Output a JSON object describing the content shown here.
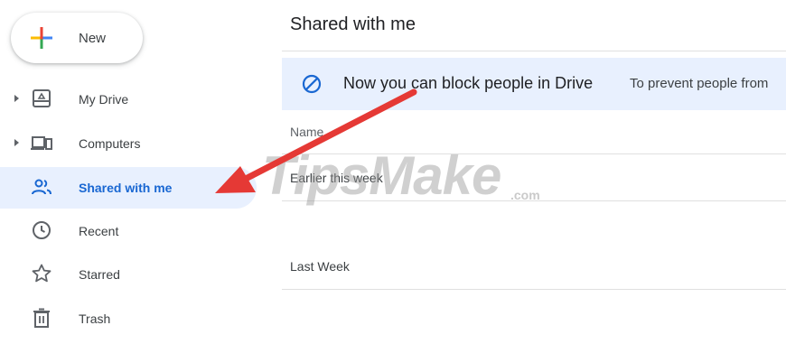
{
  "new_button": {
    "label": "New",
    "icon": "plus-multicolor-icon"
  },
  "sidebar": {
    "items": [
      {
        "label": "My Drive",
        "icon": "my-drive-icon",
        "expandable": true,
        "active": false
      },
      {
        "label": "Computers",
        "icon": "computers-icon",
        "expandable": true,
        "active": false
      },
      {
        "label": "Shared with me",
        "icon": "shared-people-icon",
        "expandable": false,
        "active": true
      },
      {
        "label": "Recent",
        "icon": "clock-icon",
        "expandable": false,
        "active": false
      },
      {
        "label": "Starred",
        "icon": "star-icon",
        "expandable": false,
        "active": false
      },
      {
        "label": "Trash",
        "icon": "trash-icon",
        "expandable": false,
        "active": false
      }
    ]
  },
  "main": {
    "title": "Shared with me",
    "banner": {
      "headline": "Now you can block people in Drive",
      "subtext": "To prevent people from",
      "icon": "block-icon"
    },
    "column_header": "Name",
    "sections": [
      "Earlier this week",
      "Last Week"
    ]
  },
  "watermark": {
    "text": "TipsMake",
    "suffix": ".com"
  },
  "colors": {
    "accent_blue": "#1967d2",
    "active_bg": "#e8f0fe",
    "arrow_red": "#e53935"
  }
}
